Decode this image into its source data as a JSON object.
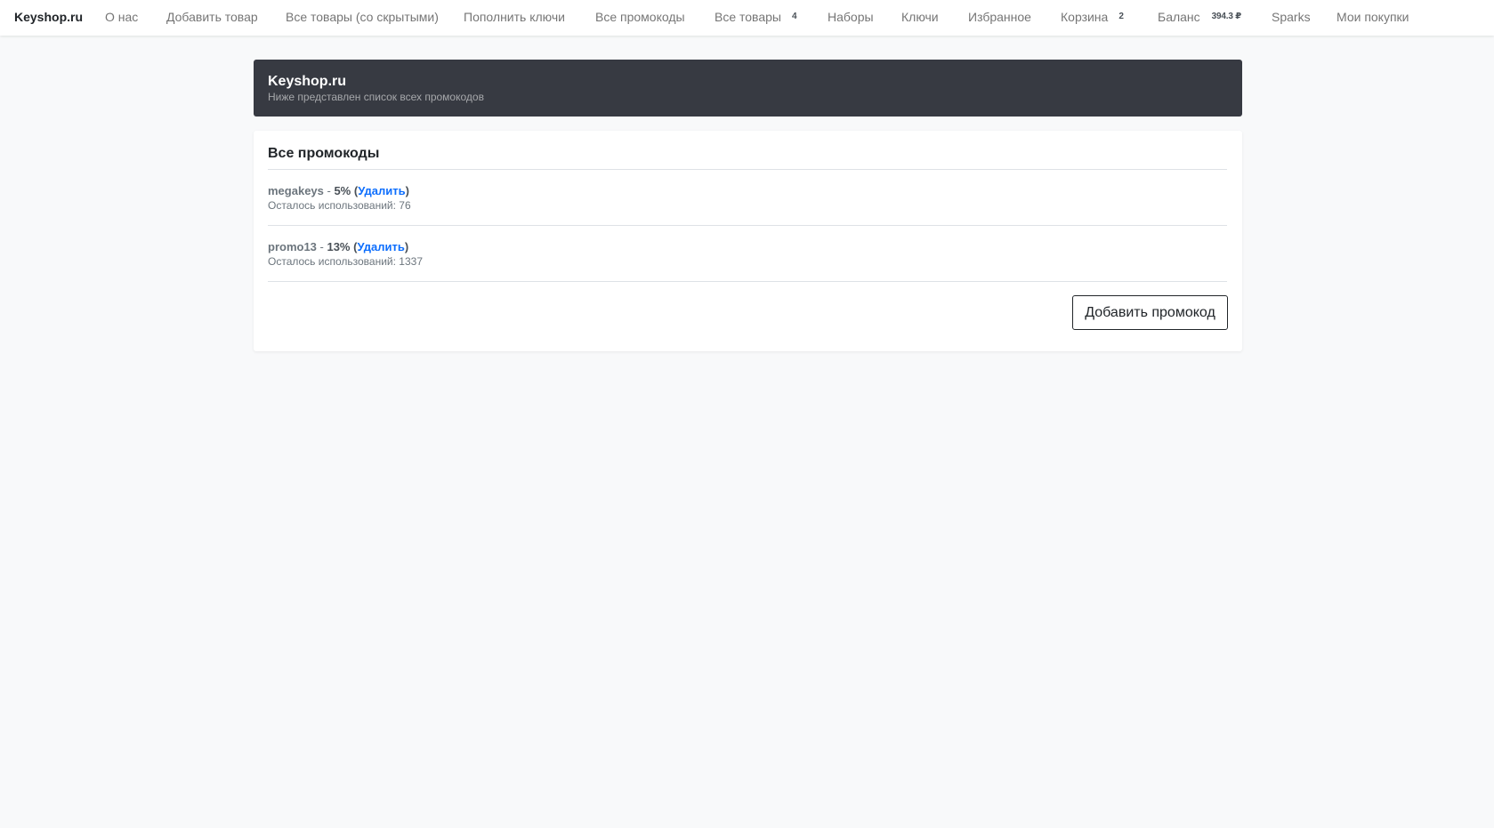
{
  "navbar": {
    "brand": "Keyshop.ru",
    "items": [
      {
        "label": "О нас"
      },
      {
        "label": "Добавить товар"
      },
      {
        "label": "Все товары (со скрытыми)"
      },
      {
        "label": "Пополнить ключи"
      },
      {
        "label": "Все промокоды"
      },
      {
        "label": "Все товары",
        "badge": "4"
      },
      {
        "label": "Наборы"
      },
      {
        "label": "Ключи"
      },
      {
        "label": "Избранное"
      },
      {
        "label": "Корзина",
        "badge": "2"
      },
      {
        "label": "Баланс",
        "badge": "394.3 ₽"
      },
      {
        "label": "Sparks"
      },
      {
        "label": "Мои покупки"
      }
    ]
  },
  "banner": {
    "title": "Keyshop.ru",
    "subtitle": "Ниже представлен список всех промокодов"
  },
  "card": {
    "title": "Все промокоды",
    "promos": [
      {
        "code": "megakeys",
        "discount": "5%",
        "delete_label": "Удалить",
        "remaining_label": "Осталось использований:",
        "remaining": "76"
      },
      {
        "code": "promo13",
        "discount": "13%",
        "delete_label": "Удалить",
        "remaining_label": "Осталось использований:",
        "remaining": "1337"
      }
    ],
    "add_button_label": "Добавить промокод"
  },
  "colors": {
    "banner_bg": "#373a42",
    "link": "#0d6efd",
    "page_bg": "#f8f9fa"
  }
}
